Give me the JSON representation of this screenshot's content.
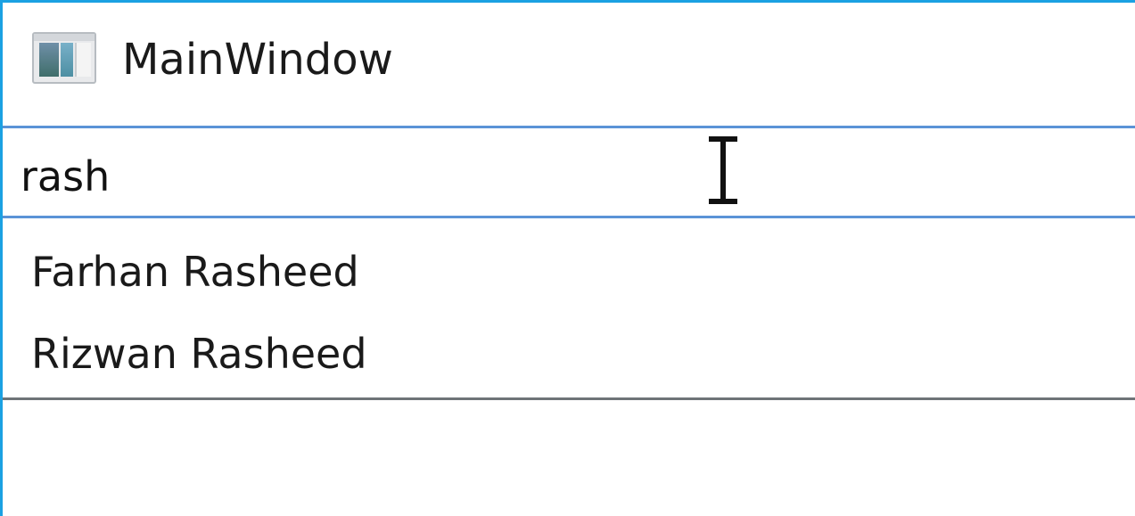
{
  "window": {
    "title": "MainWindow",
    "icon": "app-window-icon"
  },
  "search": {
    "value": "rash"
  },
  "results": [
    {
      "label": "Farhan Rasheed"
    },
    {
      "label": "Rizwan Rasheed"
    }
  ],
  "colors": {
    "window_border": "#1ba1e2",
    "input_border": "#5b93d7",
    "list_border": "#6e7478",
    "text": "#1a1a1a"
  }
}
